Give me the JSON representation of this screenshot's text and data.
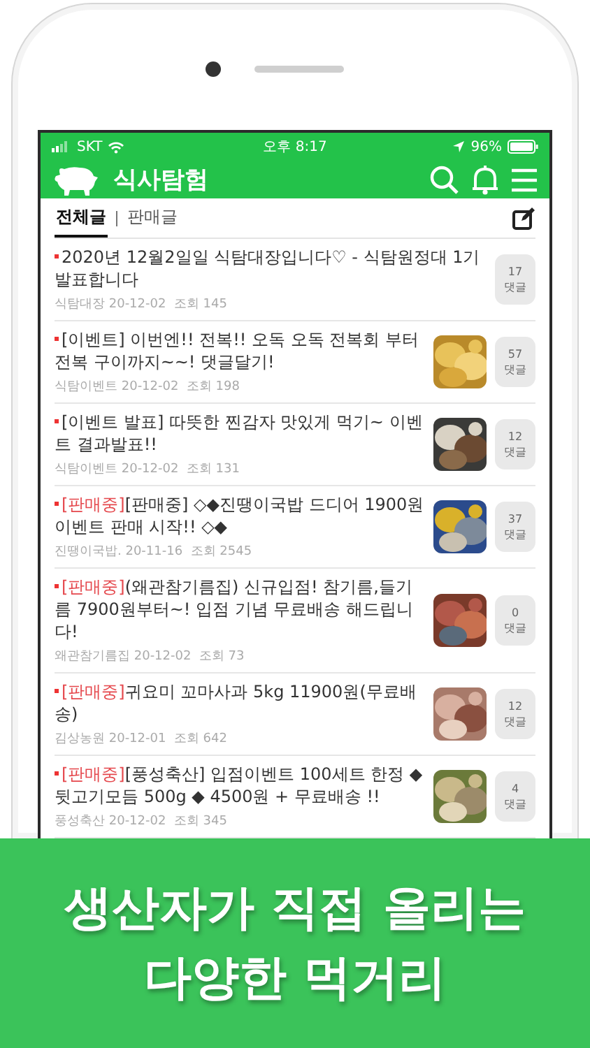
{
  "status_bar": {
    "carrier": "SKT",
    "time": "오후 8:17",
    "battery": "96%"
  },
  "header": {
    "title": "식사탐험"
  },
  "tabs": [
    {
      "label": "전체글",
      "selected": true
    },
    {
      "label": "판매글",
      "selected": false
    }
  ],
  "posts": [
    {
      "title": "2020년 12월2일일 식탐대장입니다♡ - 식탐원정대 1기 발표합니다",
      "author": "식탐대장",
      "date": "20-12-02",
      "views": "조회 145",
      "comments": "17",
      "comments_label": "댓글"
    },
    {
      "title": "[이벤트] 이번엔!! 전복!! 오독 오독 전복회 부터 전복 구이까지~~! 댓글달기!",
      "author": "식탐이벤트",
      "date": "20-12-02",
      "views": "조회 198",
      "comments": "57",
      "comments_label": "댓글"
    },
    {
      "title": "[이벤트 발표] 따뜻한 찐감자 맛있게 먹기~ 이벤트 결과발표!!",
      "author": "식탐이벤트",
      "date": "20-12-02",
      "views": "조회 131",
      "comments": "12",
      "comments_label": "댓글"
    },
    {
      "tag": "[판매중]",
      "title": "[판매중] ◇◆진땡이국밥 드디어 1900원 이벤트 판매 시작!! ◇◆",
      "author": "진땡이국밥.",
      "date": "20-11-16",
      "views": "조회 2545",
      "comments": "37",
      "comments_label": "댓글"
    },
    {
      "tag": "[판매중]",
      "title": "(왜관참기름집) 신규입점! 참기름,들기름 7900원부터~! 입점 기념 무료배송 해드립니다!",
      "author": "왜관참기름집",
      "date": "20-12-02",
      "views": "조회 73",
      "comments": "0",
      "comments_label": "댓글"
    },
    {
      "tag": "[판매중]",
      "title": "귀요미 꼬마사과 5kg 11900원(무료배송)",
      "author": "김상농원",
      "date": "20-12-01",
      "views": "조회 642",
      "comments": "12",
      "comments_label": "댓글"
    },
    {
      "tag": "[판매중]",
      "title": "[풍성축산] 입점이벤트 100세트 한정 ◆ 뒷고기모듬 500g ◆ 4500원 + 무료배송 !!",
      "author": "풍성축산",
      "date": "20-12-02",
      "views": "조회 345",
      "comments": "4",
      "comments_label": "댓글"
    }
  ],
  "banner": {
    "lines": [
      "생산자가 직접 올리는",
      "다양한 먹거리"
    ]
  }
}
